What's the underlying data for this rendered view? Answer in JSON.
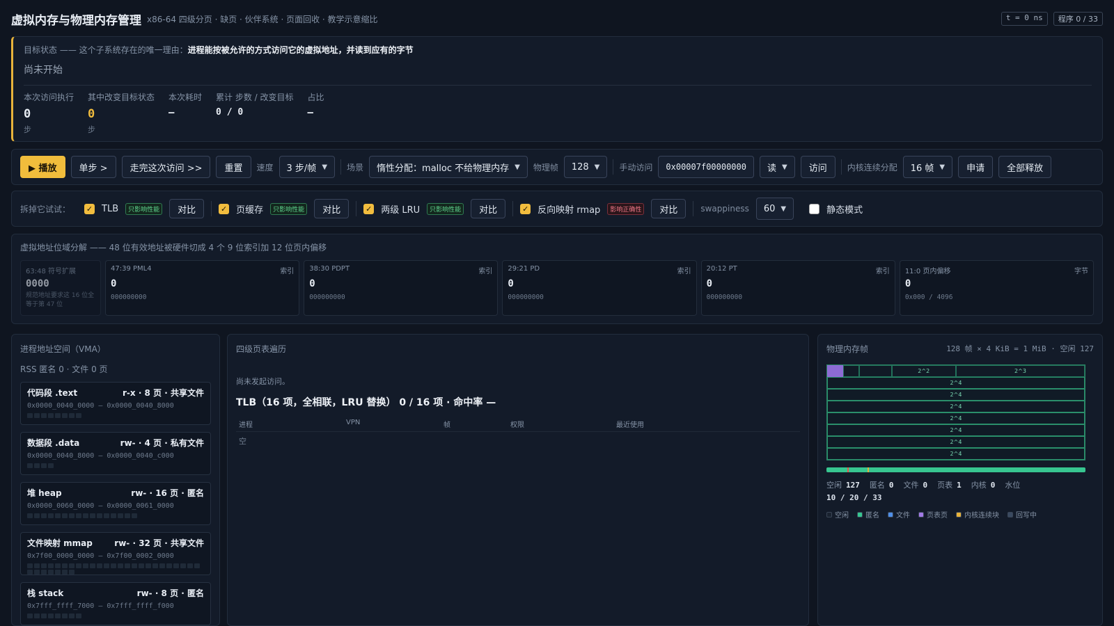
{
  "header": {
    "title": "虚拟内存与物理内存管理",
    "subtitle": "x86-64 四级分页 · 缺页 · 伙伴系统 · 页面回收 · 教学示意缩比",
    "time_pill": "t = 0 ns",
    "prog_pill": "程序 0 / 33"
  },
  "goal": {
    "prefix": "目标状态 —— 这个子系统存在的唯一理由：",
    "bold": "进程能按被允许的方式访问它的虚拟地址，并读到应有的字节",
    "status": "尚未开始",
    "stats": [
      {
        "label": "本次访问执行",
        "value": "0",
        "unit": "步"
      },
      {
        "label": "其中改变目标状态",
        "value": "0",
        "unit": "步"
      },
      {
        "label": "本次耗时",
        "value": "—",
        "unit": ""
      },
      {
        "label": "累计 步数 / 改变目标",
        "value": "0 / 0",
        "unit": ""
      },
      {
        "label": "占比",
        "value": "—",
        "unit": ""
      }
    ]
  },
  "controls": {
    "play": "▶ 播放",
    "step": "单步 >",
    "finish": "走完这次访问 >>",
    "reset": "重置",
    "speed_label": "速度",
    "speed": "3 步/帧",
    "scene_label": "场景",
    "scene": "惰性分配：malloc 不给物理内存",
    "frames_label": "物理帧",
    "frames": "128",
    "manual_label": "手动访问",
    "address": "0x00007f00000000",
    "mode": "读",
    "access": "访问",
    "kalloc_label": "内核连续分配",
    "kalloc": "16 帧",
    "apply": "申请",
    "free_all": "全部释放"
  },
  "ablation": {
    "label": "拆掉它试试：",
    "items": [
      {
        "name": "TLB",
        "tag": "只影响性能",
        "compare": "对比",
        "danger": false
      },
      {
        "name": "页缓存",
        "tag": "只影响性能",
        "compare": "对比",
        "danger": false
      },
      {
        "name": "两级 LRU",
        "tag": "只影响性能",
        "compare": "对比",
        "danger": false
      },
      {
        "name": "反向映射 rmap",
        "tag": "影响正确性",
        "compare": "对比",
        "danger": true
      }
    ],
    "swappiness_label": "swappiness",
    "swappiness": "60",
    "static_mode": "静态模式"
  },
  "addr": {
    "title": "虚拟地址位域分解 —— 48 位有效地址被硬件切成 4 个 9 位索引加 12 位页内偏移",
    "sign": {
      "head": "63:48 符号扩展",
      "value": "0000",
      "note": "规范地址要求这 16 位全等于第 47 位"
    },
    "fields": [
      {
        "head": "47:39 PML4",
        "kind": "索引",
        "value": "0",
        "bits": "000000000"
      },
      {
        "head": "38:30 PDPT",
        "kind": "索引",
        "value": "0",
        "bits": "000000000"
      },
      {
        "head": "29:21 PD",
        "kind": "索引",
        "value": "0",
        "bits": "000000000"
      },
      {
        "head": "20:12 PT",
        "kind": "索引",
        "value": "0",
        "bits": "000000000"
      },
      {
        "head": "11:0 页内偏移",
        "kind": "字节",
        "value": "0",
        "bits": "0x000 / 4096"
      }
    ]
  },
  "vma": {
    "title": "进程地址空间（VMA）",
    "summary": "RSS  匿名 0 · 文件 0 页",
    "items": [
      {
        "name": "代码段 .text",
        "perm": "r-x · 8 页 · 共享文件",
        "range": "0x0000_0040_0000 – 0x0000_0040_8000",
        "pages": 8
      },
      {
        "name": "数据段 .data",
        "perm": "rw- · 4 页 · 私有文件",
        "range": "0x0000_0040_8000 – 0x0000_0040_c000",
        "pages": 4
      },
      {
        "name": "堆 heap",
        "perm": "rw- · 16 页 · 匿名",
        "range": "0x0000_0060_0000 – 0x0000_0061_0000",
        "pages": 16
      },
      {
        "name": "文件映射 mmap",
        "perm": "rw- · 32 页 · 共享文件",
        "range": "0x7f00_0000_0000 – 0x7f00_0002_0000",
        "pages": 32
      },
      {
        "name": "栈 stack",
        "perm": "rw- · 8 页 · 匿名",
        "range": "0x7fff_ffff_7000 – 0x7fff_ffff_f000",
        "pages": 8
      }
    ]
  },
  "walk": {
    "title": "四级页表遍历",
    "note": "尚未发起访问。",
    "tlb": "TLB（16 项，全相联，LRU 替换） 0 / 16 项 · 命中率 —",
    "cols": [
      "进程",
      "VPN",
      "帧",
      "权限",
      "最近使用"
    ],
    "empty": "空"
  },
  "phys": {
    "title": "物理内存帧",
    "info": "128 帧 × 4 KiB = 1 MiB · 空闲 127",
    "block_22": "2^2",
    "block_23": "2^3",
    "block_24": "2^4",
    "counts": [
      {
        "label": "空闲",
        "value": "127"
      },
      {
        "label": "匿名",
        "value": "0"
      },
      {
        "label": "文件",
        "value": "0"
      },
      {
        "label": "页表",
        "value": "1"
      },
      {
        "label": "内核",
        "value": "0"
      }
    ],
    "water_label": "水位",
    "watermark": "10 / 20 / 33",
    "legend": [
      {
        "label": "空闲",
        "color": "#1a2330"
      },
      {
        "label": "匿名",
        "color": "#37c690"
      },
      {
        "label": "文件",
        "color": "#4f8fe8"
      },
      {
        "label": "页表页",
        "color": "#a27ae6"
      },
      {
        "label": "内核连续块",
        "color": "#e8b33b"
      },
      {
        "label": "回写中",
        "color": "#3a4a60"
      }
    ]
  }
}
